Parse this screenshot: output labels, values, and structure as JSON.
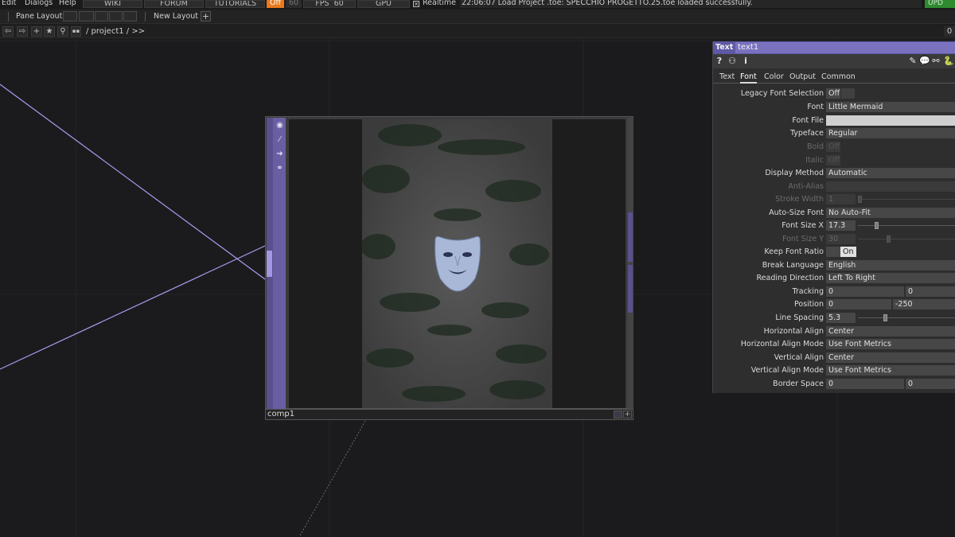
{
  "menubar": {
    "items": [
      "Edit",
      "Dialogs",
      "Help"
    ],
    "wiki": "WIKI",
    "forum": "FORUM",
    "tutorials": "TUTORIALS",
    "realtime_off": "Off",
    "fps_cap": "60",
    "fps_label": "FPS",
    "fps_value": "60",
    "gpu": "GPU",
    "realtime_check": "×",
    "realtime_label": "Realtime",
    "status": "22:06:07 Load Project .toe: SPECCHIO PROGETTO.25.toe loaded successfully.",
    "update": "UPD",
    "accent_off": "#e8791d",
    "accent_update": "#2f8a2f"
  },
  "panebar": {
    "pane_layout": "Pane Layout",
    "new_layout": "New Layout",
    "plus": "+"
  },
  "pathbar": {
    "back": "⇦",
    "forward": "⇨",
    "add": "+",
    "star": "★",
    "path": "/ project1 / >>",
    "right_value": "0"
  },
  "node": {
    "name": "comp1",
    "color": "#5b4f8e"
  },
  "param": {
    "op_type": "Text",
    "op_name": "text1",
    "header_color": "#5f58a5",
    "icons": {
      "help": "?",
      "info": "i"
    },
    "tabs": [
      "Text",
      "Font",
      "Color",
      "Output",
      "Common"
    ],
    "active_tab": "Font",
    "rows": {
      "legacy_font_selection": {
        "label": "Legacy Font Selection",
        "value": "Off"
      },
      "font": {
        "label": "Font",
        "value": "Little Mermaid"
      },
      "font_file": {
        "label": "Font File",
        "value": ""
      },
      "typeface": {
        "label": "Typeface",
        "value": "Regular"
      },
      "bold": {
        "label": "Bold",
        "value": "Off"
      },
      "italic": {
        "label": "Italic",
        "value": "Off"
      },
      "display_method": {
        "label": "Display Method",
        "value": "Automatic"
      },
      "anti_alias": {
        "label": "Anti-Alias",
        "value": ""
      },
      "stroke_width": {
        "label": "Stroke Width",
        "value": "1"
      },
      "auto_size_font": {
        "label": "Auto-Size Font",
        "value": "No Auto-Fit"
      },
      "font_size_x": {
        "label": "Font Size X",
        "value": "17.3"
      },
      "font_size_y": {
        "label": "Font Size Y",
        "value": "30"
      },
      "keep_font_ratio": {
        "label": "Keep Font Ratio",
        "value": "On"
      },
      "break_language": {
        "label": "Break Language",
        "value": "English"
      },
      "reading_direction": {
        "label": "Reading Direction",
        "value": "Left To Right"
      },
      "tracking": {
        "label": "Tracking",
        "value": "0",
        "value2": "0"
      },
      "position": {
        "label": "Position",
        "value": "0",
        "value2": "-250"
      },
      "line_spacing": {
        "label": "Line Spacing",
        "value": "5.3"
      },
      "horizontal_align": {
        "label": "Horizontal Align",
        "value": "Center"
      },
      "horizontal_align_mode": {
        "label": "Horizontal Align Mode",
        "value": "Use Font Metrics"
      },
      "vertical_align": {
        "label": "Vertical Align",
        "value": "Center"
      },
      "vertical_align_mode": {
        "label": "Vertical Align Mode",
        "value": "Use Font Metrics"
      },
      "border_space": {
        "label": "Border Space",
        "value": "0",
        "value2": "0"
      }
    }
  }
}
